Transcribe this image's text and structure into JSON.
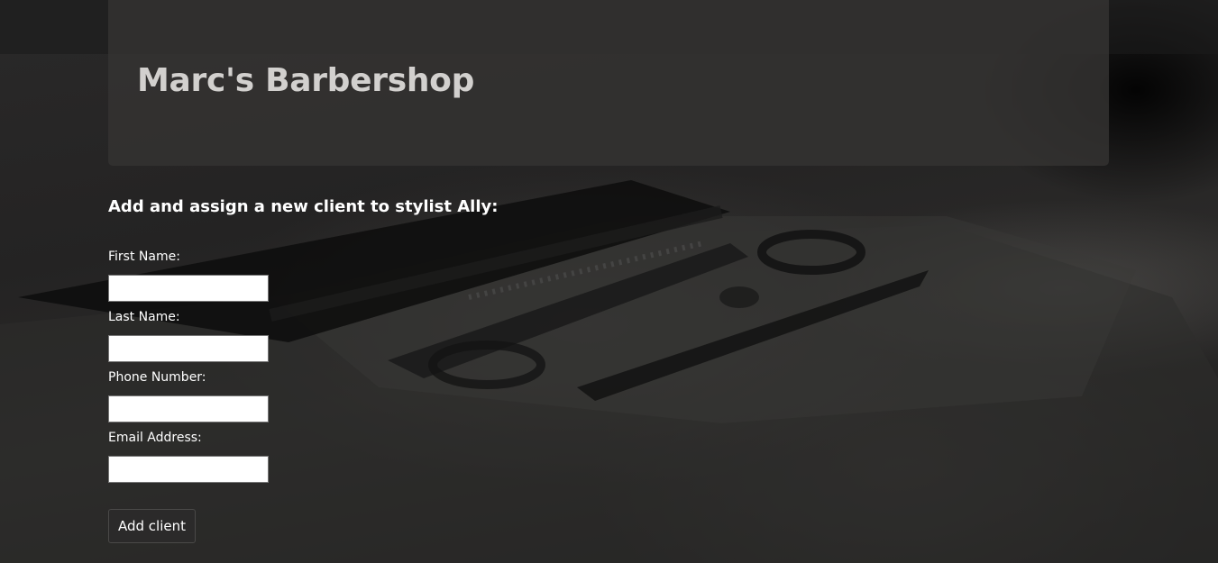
{
  "header": {
    "title": "Marc's Barbershop"
  },
  "form": {
    "heading": "Add and assign a new client to stylist Ally:",
    "fields": [
      {
        "label": "First Name:",
        "value": ""
      },
      {
        "label": "Last Name:",
        "value": ""
      },
      {
        "label": "Phone Number:",
        "value": ""
      },
      {
        "label": "Email Address:",
        "value": ""
      }
    ],
    "submit_label": "Add client"
  },
  "colors": {
    "header_panel": "#343332",
    "title_text": "#d2d0ce",
    "button_bg": "#2b2a2a"
  }
}
